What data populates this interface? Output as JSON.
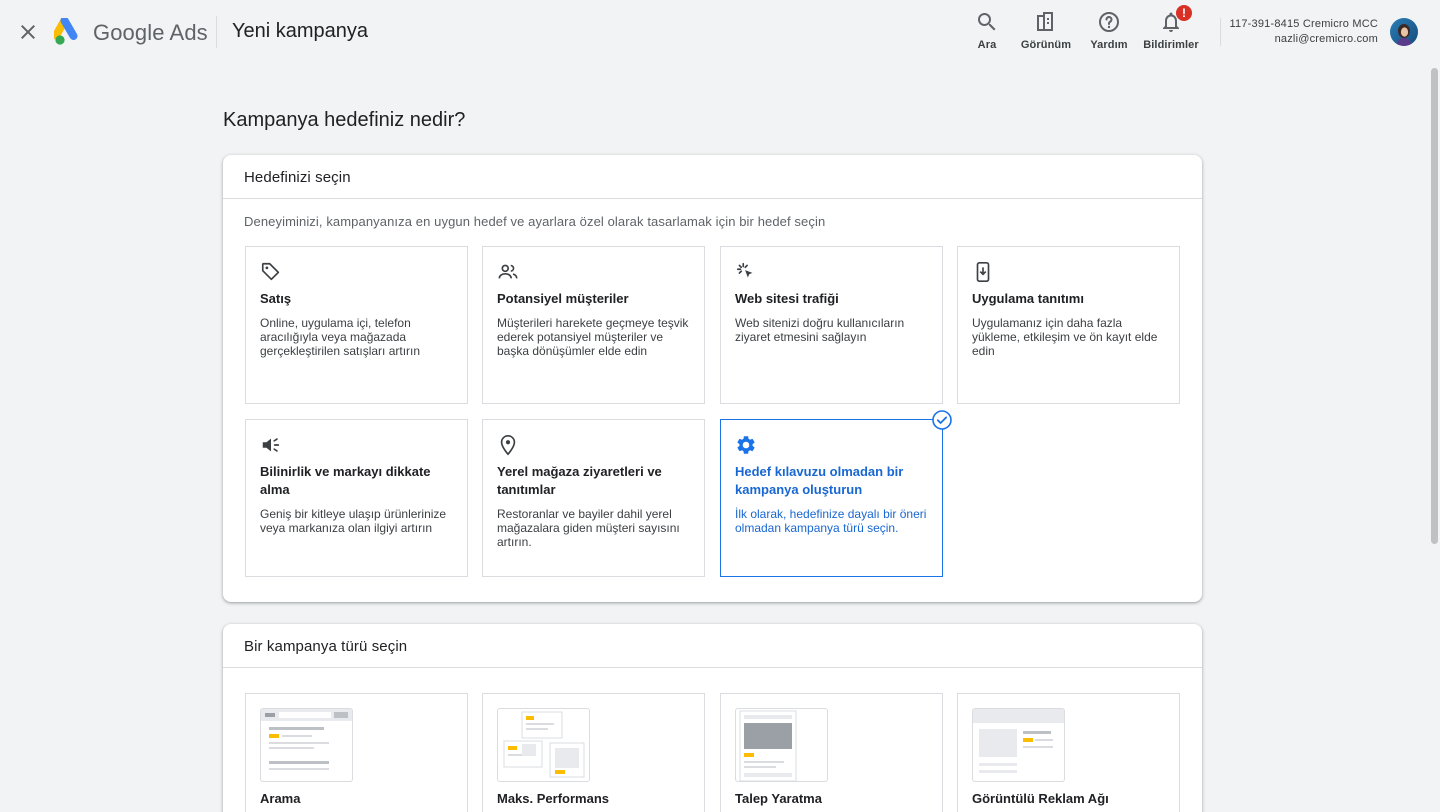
{
  "header": {
    "brand": "Google Ads",
    "page_name": "Yeni kampanya",
    "buttons": {
      "search": "Ara",
      "appearance": "Görünüm",
      "help": "Yardım",
      "notifications": "Bildirimler"
    },
    "notification_badge": "!",
    "account_id": "117-391-8415 Cremicro MCC",
    "account_email": "nazli@cremicro.com"
  },
  "main": {
    "title": "Kampanya hedefiniz nedir?"
  },
  "goal_card": {
    "heading": "Hedefinizi seçin",
    "subtitle": "Deneyiminizi, kampanyanıza en uygun hedef ve ayarlara özel olarak tasarlamak için bir hedef seçin",
    "goals": [
      {
        "title": "Satış",
        "desc": "Online, uygulama içi, telefon aracılığıyla veya mağazada gerçekleştirilen satışları artırın",
        "icon": "tag-icon"
      },
      {
        "title": "Potansiyel müşteriler",
        "desc": "Müşterileri harekete geçmeye teşvik ederek potansiyel müşteriler ve başka dönüşümler elde edin",
        "icon": "people-icon"
      },
      {
        "title": "Web sitesi trafiği",
        "desc": "Web sitenizi doğru kullanıcıların ziyaret etmesini sağlayın",
        "icon": "cursor-click-icon"
      },
      {
        "title": "Uygulama tanıtımı",
        "desc": "Uygulamanız için daha fazla yükleme, etkileşim ve ön kayıt elde edin",
        "icon": "phone-download-icon"
      },
      {
        "title": "Bilinirlik ve markayı dikkate alma",
        "desc": "Geniş bir kitleye ulaşıp ürünlerinize veya markanıza olan ilgiyi artırın",
        "icon": "megaphone-icon"
      },
      {
        "title": "Yerel mağaza ziyaretleri ve tanıtımlar",
        "desc": "Restoranlar ve bayiler dahil yerel mağazalara giden müşteri sayısını artırın.",
        "icon": "location-pin-icon"
      },
      {
        "title": "Hedef kılavuzu olmadan bir kampanya oluşturun",
        "desc": "İlk olarak, hedefinize dayalı bir öneri olmadan kampanya türü seçin.",
        "icon": "gear-icon",
        "selected": true
      }
    ]
  },
  "type_card": {
    "heading": "Bir kampanya türü seçin",
    "types": [
      {
        "title": "Arama"
      },
      {
        "title": "Maks. Performans"
      },
      {
        "title": "Talep Yaratma"
      },
      {
        "title": "Görüntülü Reklam Ağı"
      }
    ]
  },
  "colors": {
    "accent": "#1a73e8",
    "selected_text": "#1967d2",
    "badge": "#d93025",
    "ad_yellow": "#fbbc04"
  }
}
